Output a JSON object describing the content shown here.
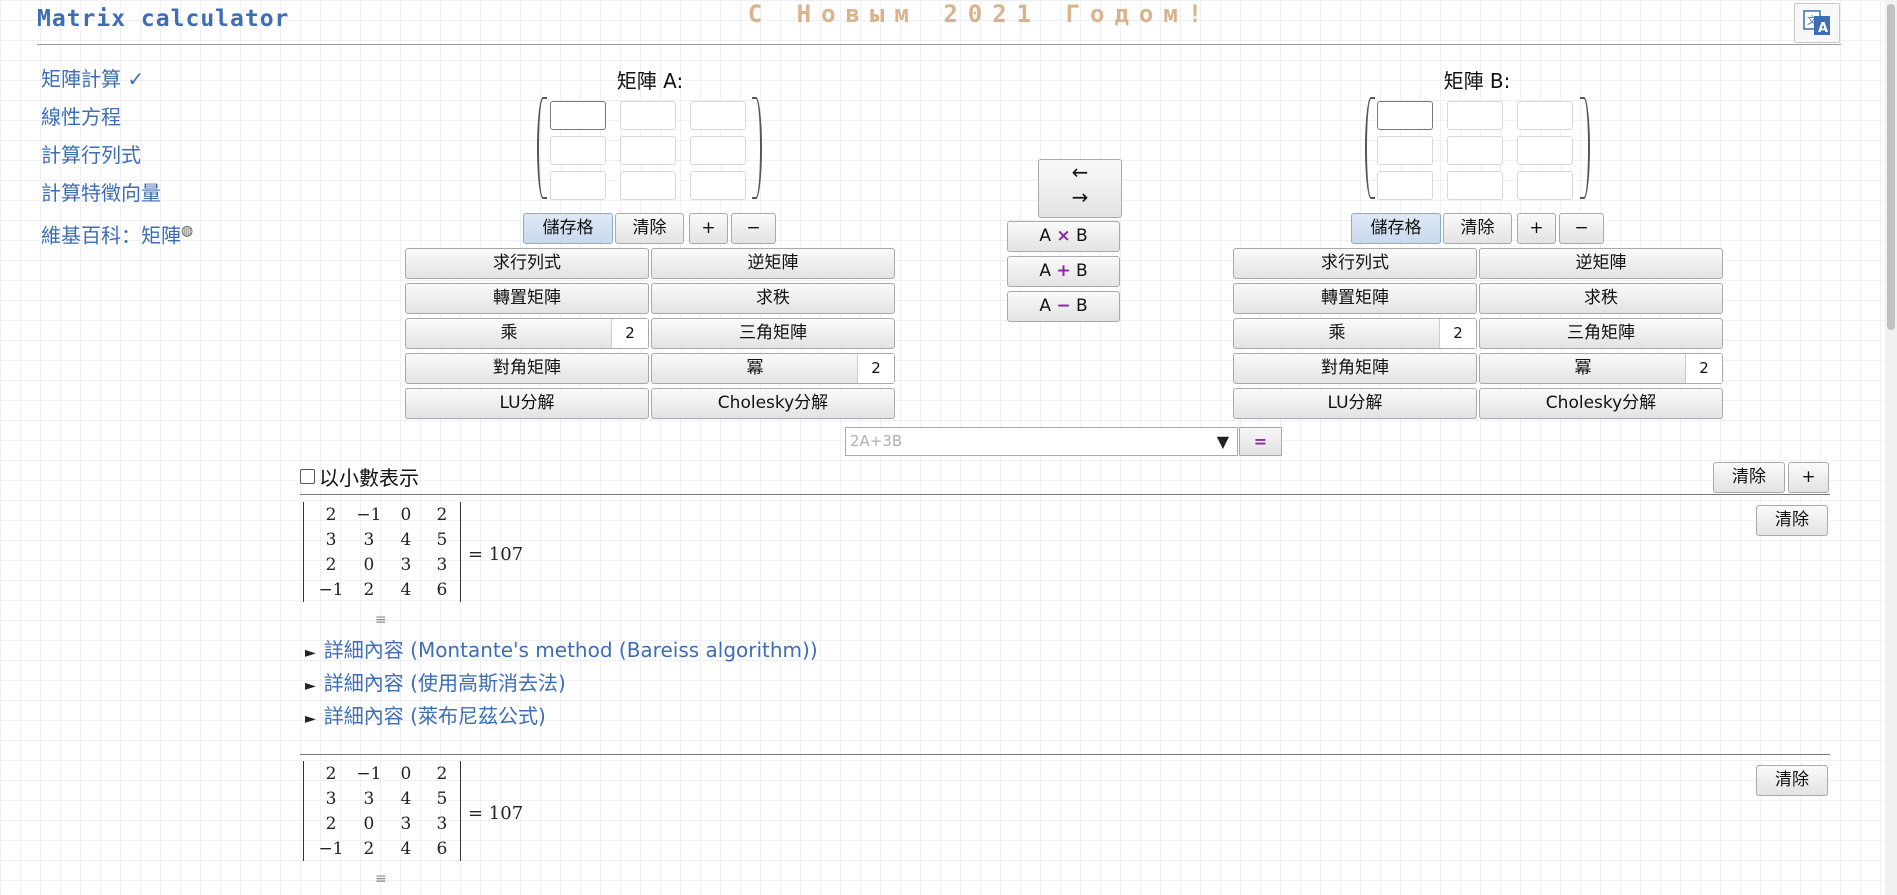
{
  "header": {
    "title": "Matrix calculator",
    "greeting": "С Новым 2021 Годом!",
    "translate_icon": "translate-icon"
  },
  "nav": {
    "items": [
      {
        "label": "矩陣計算 ✓"
      },
      {
        "label": "線性方程"
      },
      {
        "label": "計算行列式"
      },
      {
        "label": "計算特徵向量"
      },
      {
        "label": "維基百科：矩陣"
      }
    ]
  },
  "matrixA": {
    "label": "矩陣 A:",
    "cells": [
      "",
      "",
      "",
      "",
      "",
      "",
      "",
      "",
      ""
    ],
    "controls": {
      "cells_label": "儲存格",
      "clear_label": "清除",
      "plus_label": "+",
      "minus_label": "−"
    },
    "ops": {
      "determinant": "求行列式",
      "inverse": "逆矩陣",
      "transpose": "轉置矩陣",
      "rank": "求秩",
      "multiply": "乘",
      "multiply_value": "2",
      "triangular": "三角矩陣",
      "diagonal": "對角矩陣",
      "power": "冪",
      "power_value": "2",
      "lu": "LU分解",
      "cholesky": "Cholesky分解"
    }
  },
  "matrixB": {
    "label": "矩陣 B:",
    "cells": [
      "",
      "",
      "",
      "",
      "",
      "",
      "",
      "",
      ""
    ],
    "controls": {
      "cells_label": "儲存格",
      "clear_label": "清除",
      "plus_label": "+",
      "minus_label": "−"
    },
    "ops": {
      "determinant": "求行列式",
      "inverse": "逆矩陣",
      "transpose": "轉置矩陣",
      "rank": "求秩",
      "multiply": "乘",
      "multiply_value": "2",
      "triangular": "三角矩陣",
      "diagonal": "對角矩陣",
      "power": "冪",
      "power_value": "2",
      "lu": "LU分解",
      "cholesky": "Cholesky分解"
    }
  },
  "middle": {
    "swap_left": "←",
    "swap_right": "→",
    "a_times_b": {
      "a": "A",
      "op": "×",
      "b": "B"
    },
    "a_plus_b": {
      "a": "A",
      "op": "+",
      "b": "B"
    },
    "a_minus_b": {
      "a": "A",
      "op": "−",
      "b": "B"
    }
  },
  "expression": {
    "placeholder": "2A+3B",
    "arrow": "▼",
    "equals": "="
  },
  "results": {
    "decimal_label": "以小數表示",
    "clear_all": "清除",
    "add": "+",
    "entries": [
      {
        "clear": "清除",
        "rows": [
          [
            "2",
            "−1",
            "0",
            "2"
          ],
          [
            "3",
            "3",
            "4",
            "5"
          ],
          [
            "2",
            "0",
            "3",
            "3"
          ],
          [
            "−1",
            "2",
            "4",
            "6"
          ]
        ],
        "result": "= 107",
        "menu_glyph": "≡",
        "details": [
          "詳細內容 (Montante's method (Bareiss algorithm))",
          "詳細內容 (使用高斯消去法)",
          "詳細內容 (萊布尼茲公式)"
        ],
        "detail_marker": "►"
      },
      {
        "clear": "清除",
        "rows": [
          [
            "2",
            "−1",
            "0",
            "2"
          ],
          [
            "3",
            "3",
            "4",
            "5"
          ],
          [
            "2",
            "0",
            "3",
            "3"
          ],
          [
            "−1",
            "2",
            "4",
            "6"
          ]
        ],
        "result": "= 107",
        "menu_glyph": "≡"
      }
    ]
  }
}
